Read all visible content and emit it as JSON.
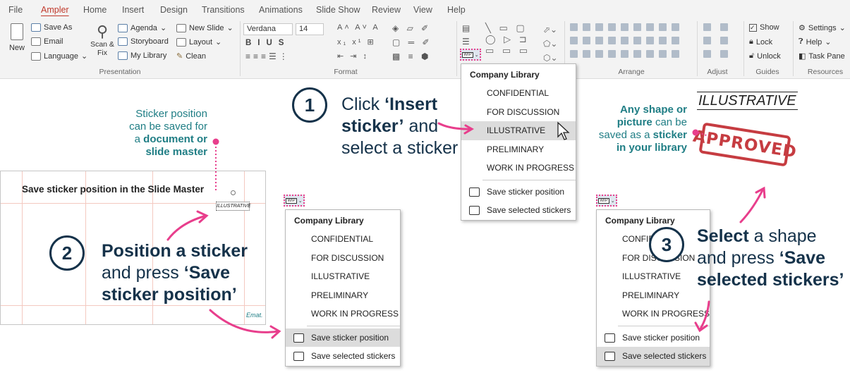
{
  "tabs": [
    "File",
    "Ampler",
    "Home",
    "Insert",
    "Design",
    "Transitions",
    "Animations",
    "Slide Show",
    "Review",
    "View",
    "Help"
  ],
  "ribbon": {
    "new_label": "New",
    "save_as": "Save As",
    "email": "Email",
    "language": "Language",
    "scan_fix": "Scan & Fix",
    "agenda": "Agenda",
    "storyboard": "Storyboard",
    "my_library": "My Library",
    "new_slide": "New Slide",
    "layout": "Layout",
    "clean": "Clean",
    "font_name": "Verdana",
    "font_size": "14",
    "show": "Show",
    "lock": "Lock",
    "unlock": "Unlock",
    "settings": "Settings",
    "help": "Help",
    "task_pane": "Task Pane",
    "groups": [
      "Presentation",
      "Format",
      "Arrange",
      "Adjust",
      "Guides",
      "Resources"
    ]
  },
  "sticker_menu": {
    "header": "Company Library",
    "items": [
      "CONFIDENTIAL",
      "FOR DISCUSSION",
      "ILLUSTRATIVE",
      "PRELIMINARY",
      "WORK IN PROGRESS"
    ],
    "save_position": "Save sticker position",
    "save_selected": "Save selected stickers"
  },
  "wip_label": "WIP",
  "step1": {
    "num": "1",
    "l1a": "Click ",
    "l1b": "‘Insert",
    "l2a": "sticker’",
    "l2b": " and",
    "l3": "select a sticker"
  },
  "step2": {
    "num": "2",
    "l1": "Position a sticker",
    "l2a": "and press ",
    "l2b": "‘Save",
    "l3": "sticker position’"
  },
  "step3": {
    "num": "3",
    "l1a": "Select",
    "l1b": " a shape",
    "l2a": "and press ",
    "l2b": "‘Save",
    "l3": "selected stickers’"
  },
  "note_left": {
    "l1": "Sticker position",
    "l2": "can be saved for",
    "l3a": "a ",
    "l3b": "document or",
    "l4": "slide master"
  },
  "note_right": {
    "l1": "Any shape or",
    "l2a": "picture",
    "l2b": " can be",
    "l3a": "saved as a ",
    "l3b": "sticker",
    "l4": "in your library"
  },
  "slide": {
    "title": "Save sticker position in the Slide Master",
    "sticker_text": "ILLUSTRATIVE",
    "logo": "Emat."
  },
  "illustrative_big": "ILLUSTRATIVE",
  "approved": "APPROVED",
  "colors": {
    "teal": "#207e85",
    "navy": "#15324a",
    "pink": "#e83e8c",
    "tab_active": "#c0392b"
  }
}
